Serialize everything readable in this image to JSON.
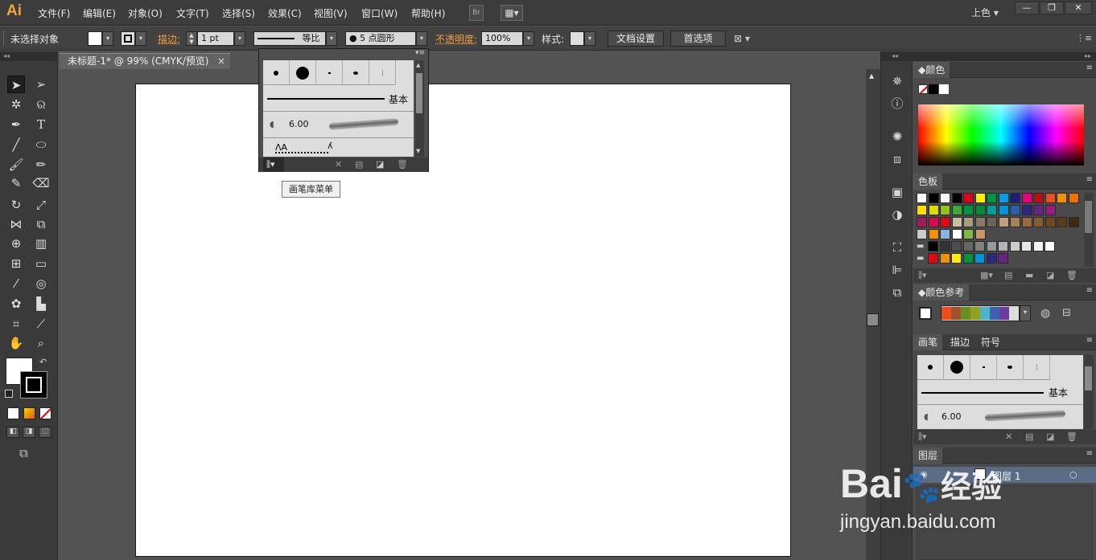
{
  "app": {
    "logo": "Ai",
    "workspace": "上色",
    "br_label": "Br"
  },
  "menu": [
    "文件(F)",
    "编辑(E)",
    "对象(O)",
    "文字(T)",
    "选择(S)",
    "效果(C)",
    "视图(V)",
    "窗口(W)",
    "帮助(H)"
  ],
  "window_buttons": {
    "minimize": "—",
    "restore": "❐",
    "close": "✕"
  },
  "control": {
    "no_selection": "未选择对象",
    "stroke_label": "描边:",
    "stroke_weight": "1 pt",
    "stroke_profile": "等比",
    "brush_def": "● 5 点圆形",
    "opacity_label": "不透明度:",
    "opacity_value": "100%",
    "style_label": "样式:",
    "doc_setup": "文档设置",
    "preferences": "首选项"
  },
  "document": {
    "tab_title": "未标题-1* @ 99% (CMYK/预览)",
    "close": "×"
  },
  "brush_popup": {
    "basic_label": "基本",
    "size_label": "6.00",
    "tooltip": "画笔库菜单"
  },
  "panels": {
    "color": {
      "title": "颜色"
    },
    "swatches": {
      "title": "色板"
    },
    "color_guide": {
      "title": "颜色参考"
    },
    "brushes": {
      "tabs": [
        "画笔",
        "描边",
        "符号"
      ],
      "basic_label": "基本",
      "size_label": "6.00"
    },
    "layers": {
      "title": "图层",
      "layer_name": "图层 1"
    }
  },
  "swatch_rows": [
    [
      "#ffffff",
      "#000000",
      "#ffffff",
      "#000000",
      "#e2001a",
      "#ffed00",
      "#00963f",
      "#009fe3",
      "#1d1d7b",
      "#e6007e",
      "#b60f16",
      "#e94e1b",
      "#f39200",
      "#ee7203"
    ],
    [
      "#ffdd00",
      "#dedc00",
      "#95c11f",
      "#3aaa35",
      "#009640",
      "#008d36",
      "#009e97",
      "#0095db",
      "#2a5ea8",
      "#312783",
      "#662483",
      "#951b81"
    ],
    [
      "#a3195b",
      "#d60b52",
      "#e30613",
      "#cbbb9f",
      "#a79d81",
      "#867a62",
      "#706251",
      "#bfa07a",
      "#a68456",
      "#956b3f",
      "#8a5a2a",
      "#6e4622",
      "#5c3b1b",
      "#412812"
    ],
    [
      "#cccccc",
      "#f39200",
      "#8ab4e0",
      "#ffffff",
      "#7fba45",
      "#c9956b"
    ],
    [
      "#000000",
      "#333333",
      "#4d4d4d",
      "#666666",
      "#808080",
      "#999999",
      "#b3b3b3",
      "#cccccc",
      "#e6e6e6",
      "#f2f2f2",
      "#ffffff"
    ],
    [
      "#e30613",
      "#f39200",
      "#ffed00",
      "#00963f",
      "#0095db",
      "#2a2a7c",
      "#662483"
    ]
  ],
  "guide_colors": [
    "#e94e1b",
    "#a0522d",
    "#6b8e23",
    "#8fa31d",
    "#4fb3c9",
    "#3b62b0",
    "#6a3d9a",
    "#dcdcdc"
  ],
  "accent_color": "#f0a03a",
  "watermark": {
    "line1": "Bai",
    "line2": "经验",
    "url": "jingyan.baidu.com"
  }
}
